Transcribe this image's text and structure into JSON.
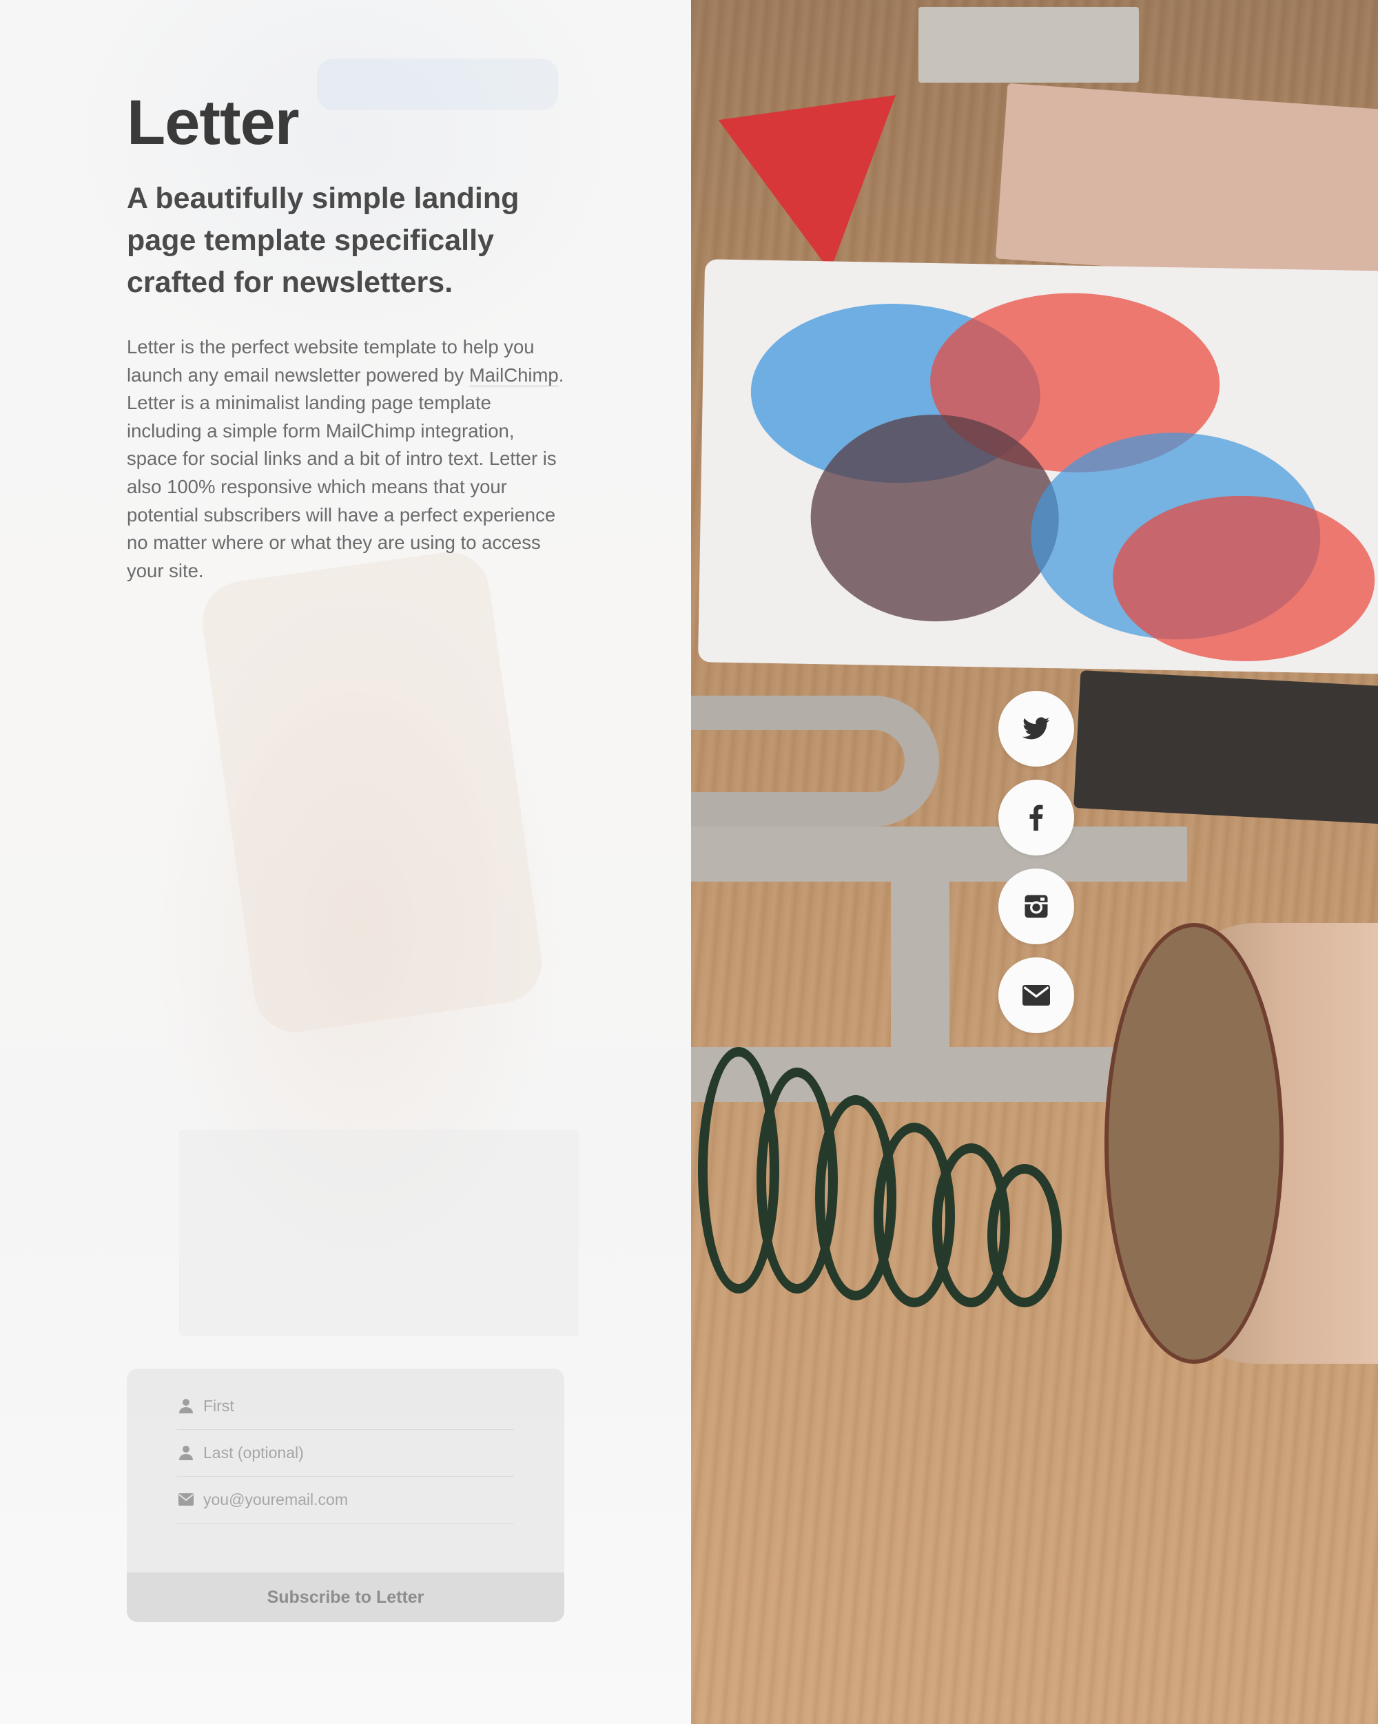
{
  "page": {
    "title": "Letter",
    "subtitle": "A beautifully simple landing page template specifically crafted for newsletters.",
    "intro_before_link": "Letter is the perfect website template to help you launch any email newsletter powered by ",
    "intro_link": "MailChimp",
    "intro_after_link": ". Letter is a minimalist landing page template including a simple form MailChimp integration, space for social links and a bit of intro text. Letter is also 100% responsive which means that your potential subscribers will have a perfect experience no matter where or what they are using to access your site."
  },
  "form": {
    "first_placeholder": "First",
    "last_placeholder": "Last (optional)",
    "email_placeholder": "you@youremail.com",
    "submit_label": "Subscribe to Letter"
  },
  "social": [
    {
      "icon": "twitter-icon"
    },
    {
      "icon": "facebook-icon"
    },
    {
      "icon": "instagram-icon"
    },
    {
      "icon": "email-icon"
    }
  ],
  "colors": {
    "title": "#3a3a3a",
    "body_text": "#6b6b6b",
    "form_background": "#e6e6e6",
    "button_background": "#dcdcdc",
    "social_button": "#fbfbfb"
  }
}
